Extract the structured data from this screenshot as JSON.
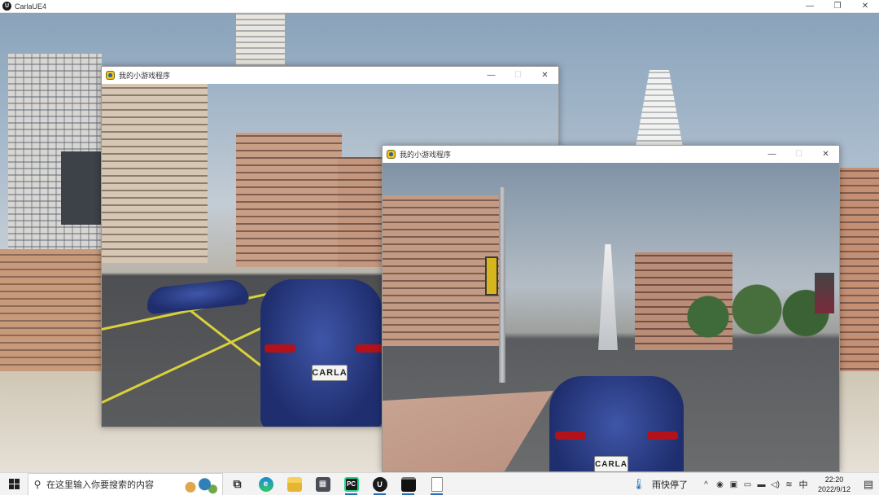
{
  "main_window": {
    "title": "CarlaUE4",
    "logo_text": "U",
    "controls": {
      "minimize": "—",
      "maximize": "❐",
      "close": "✕"
    }
  },
  "pygame_windows": [
    {
      "title": "我的小游戏程序",
      "controls": {
        "minimize": "—",
        "maximize": "☐",
        "close": "✕"
      },
      "plate": "CARLA"
    },
    {
      "title": "我的小游戏程序",
      "controls": {
        "minimize": "—",
        "maximize": "☐",
        "close": "✕"
      },
      "plate": "CARLA"
    }
  ],
  "taskbar": {
    "search_glyph": "⚲",
    "search_placeholder": "在这里输入你要搜索的内容",
    "apps": [
      {
        "name": "task-view",
        "glyph": "⧉"
      },
      {
        "name": "edge",
        "glyph": "e"
      },
      {
        "name": "file-explorer",
        "glyph": ""
      },
      {
        "name": "calculator",
        "glyph": "▦"
      },
      {
        "name": "pycharm",
        "glyph": "PC"
      },
      {
        "name": "unreal-engine",
        "glyph": "U"
      },
      {
        "name": "console",
        "glyph": ""
      },
      {
        "name": "document",
        "glyph": ""
      }
    ],
    "weather_glyph": "🌡",
    "weather_text": "雨快停了",
    "tray_glyphs": [
      "^",
      "◉",
      "▣",
      "▭",
      "▬",
      "◁)",
      "≋"
    ],
    "ime": "中",
    "time": "22:20",
    "date": "2022/9/12",
    "notification_glyph": "▤"
  },
  "colors": {
    "taskbar_bg": "#f3f3f3",
    "accent": "#2a6ab0",
    "car_blue": "#1f2e6e",
    "road_line": "#d9d13c"
  }
}
